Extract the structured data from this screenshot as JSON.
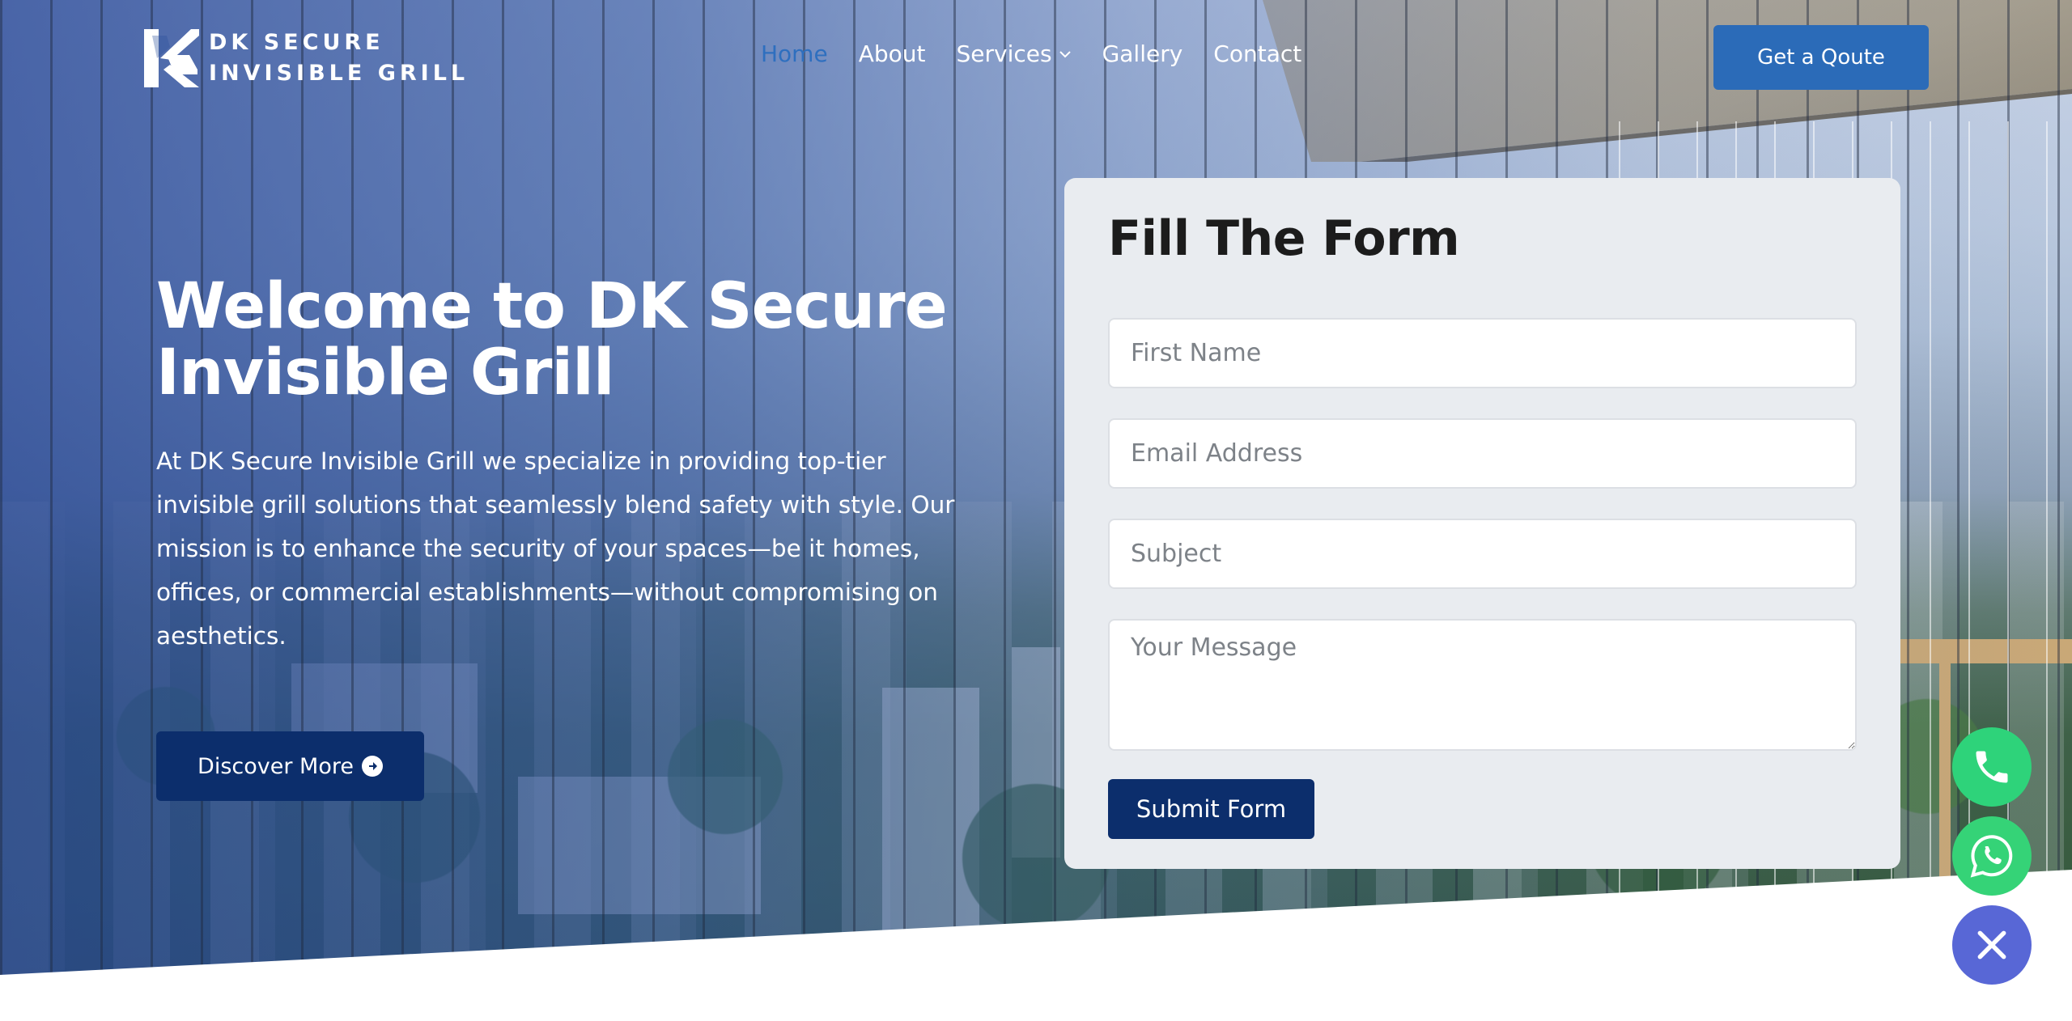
{
  "brand": {
    "line1": "DK SECURE",
    "line2": "INVISIBLE GRILL"
  },
  "nav": {
    "items": [
      {
        "label": "Home",
        "active": true
      },
      {
        "label": "About"
      },
      {
        "label": "Services",
        "has_dropdown": true
      },
      {
        "label": "Gallery"
      },
      {
        "label": "Contact"
      }
    ],
    "cta": "Get a Qoute"
  },
  "hero": {
    "title": "Welcome to DK Secure Invisible Grill",
    "description": "At DK Secure Invisible Grill we specialize in providing top-tier invisible grill solutions that seamlessly blend safety with style. Our mission is to enhance the security of your spaces—be it homes, offices, or commercial establishments—without compromising on aesthetics.",
    "button": "Discover More"
  },
  "form": {
    "title": "Fill The Form",
    "first_name_placeholder": "First Name",
    "email_placeholder": "Email Address",
    "subject_placeholder": "Subject",
    "message_placeholder": "Your Message",
    "submit": "Submit Form"
  },
  "floating": {
    "phone_icon": "phone-icon",
    "whatsapp_icon": "whatsapp-icon",
    "close_icon": "close-icon"
  },
  "colors": {
    "primary": "#0c2e6c",
    "accent": "#2b6bb8",
    "nav_active": "#2e6fbf",
    "phone": "#2ed37a",
    "whatsapp": "#35d377",
    "close": "#5867d6"
  }
}
